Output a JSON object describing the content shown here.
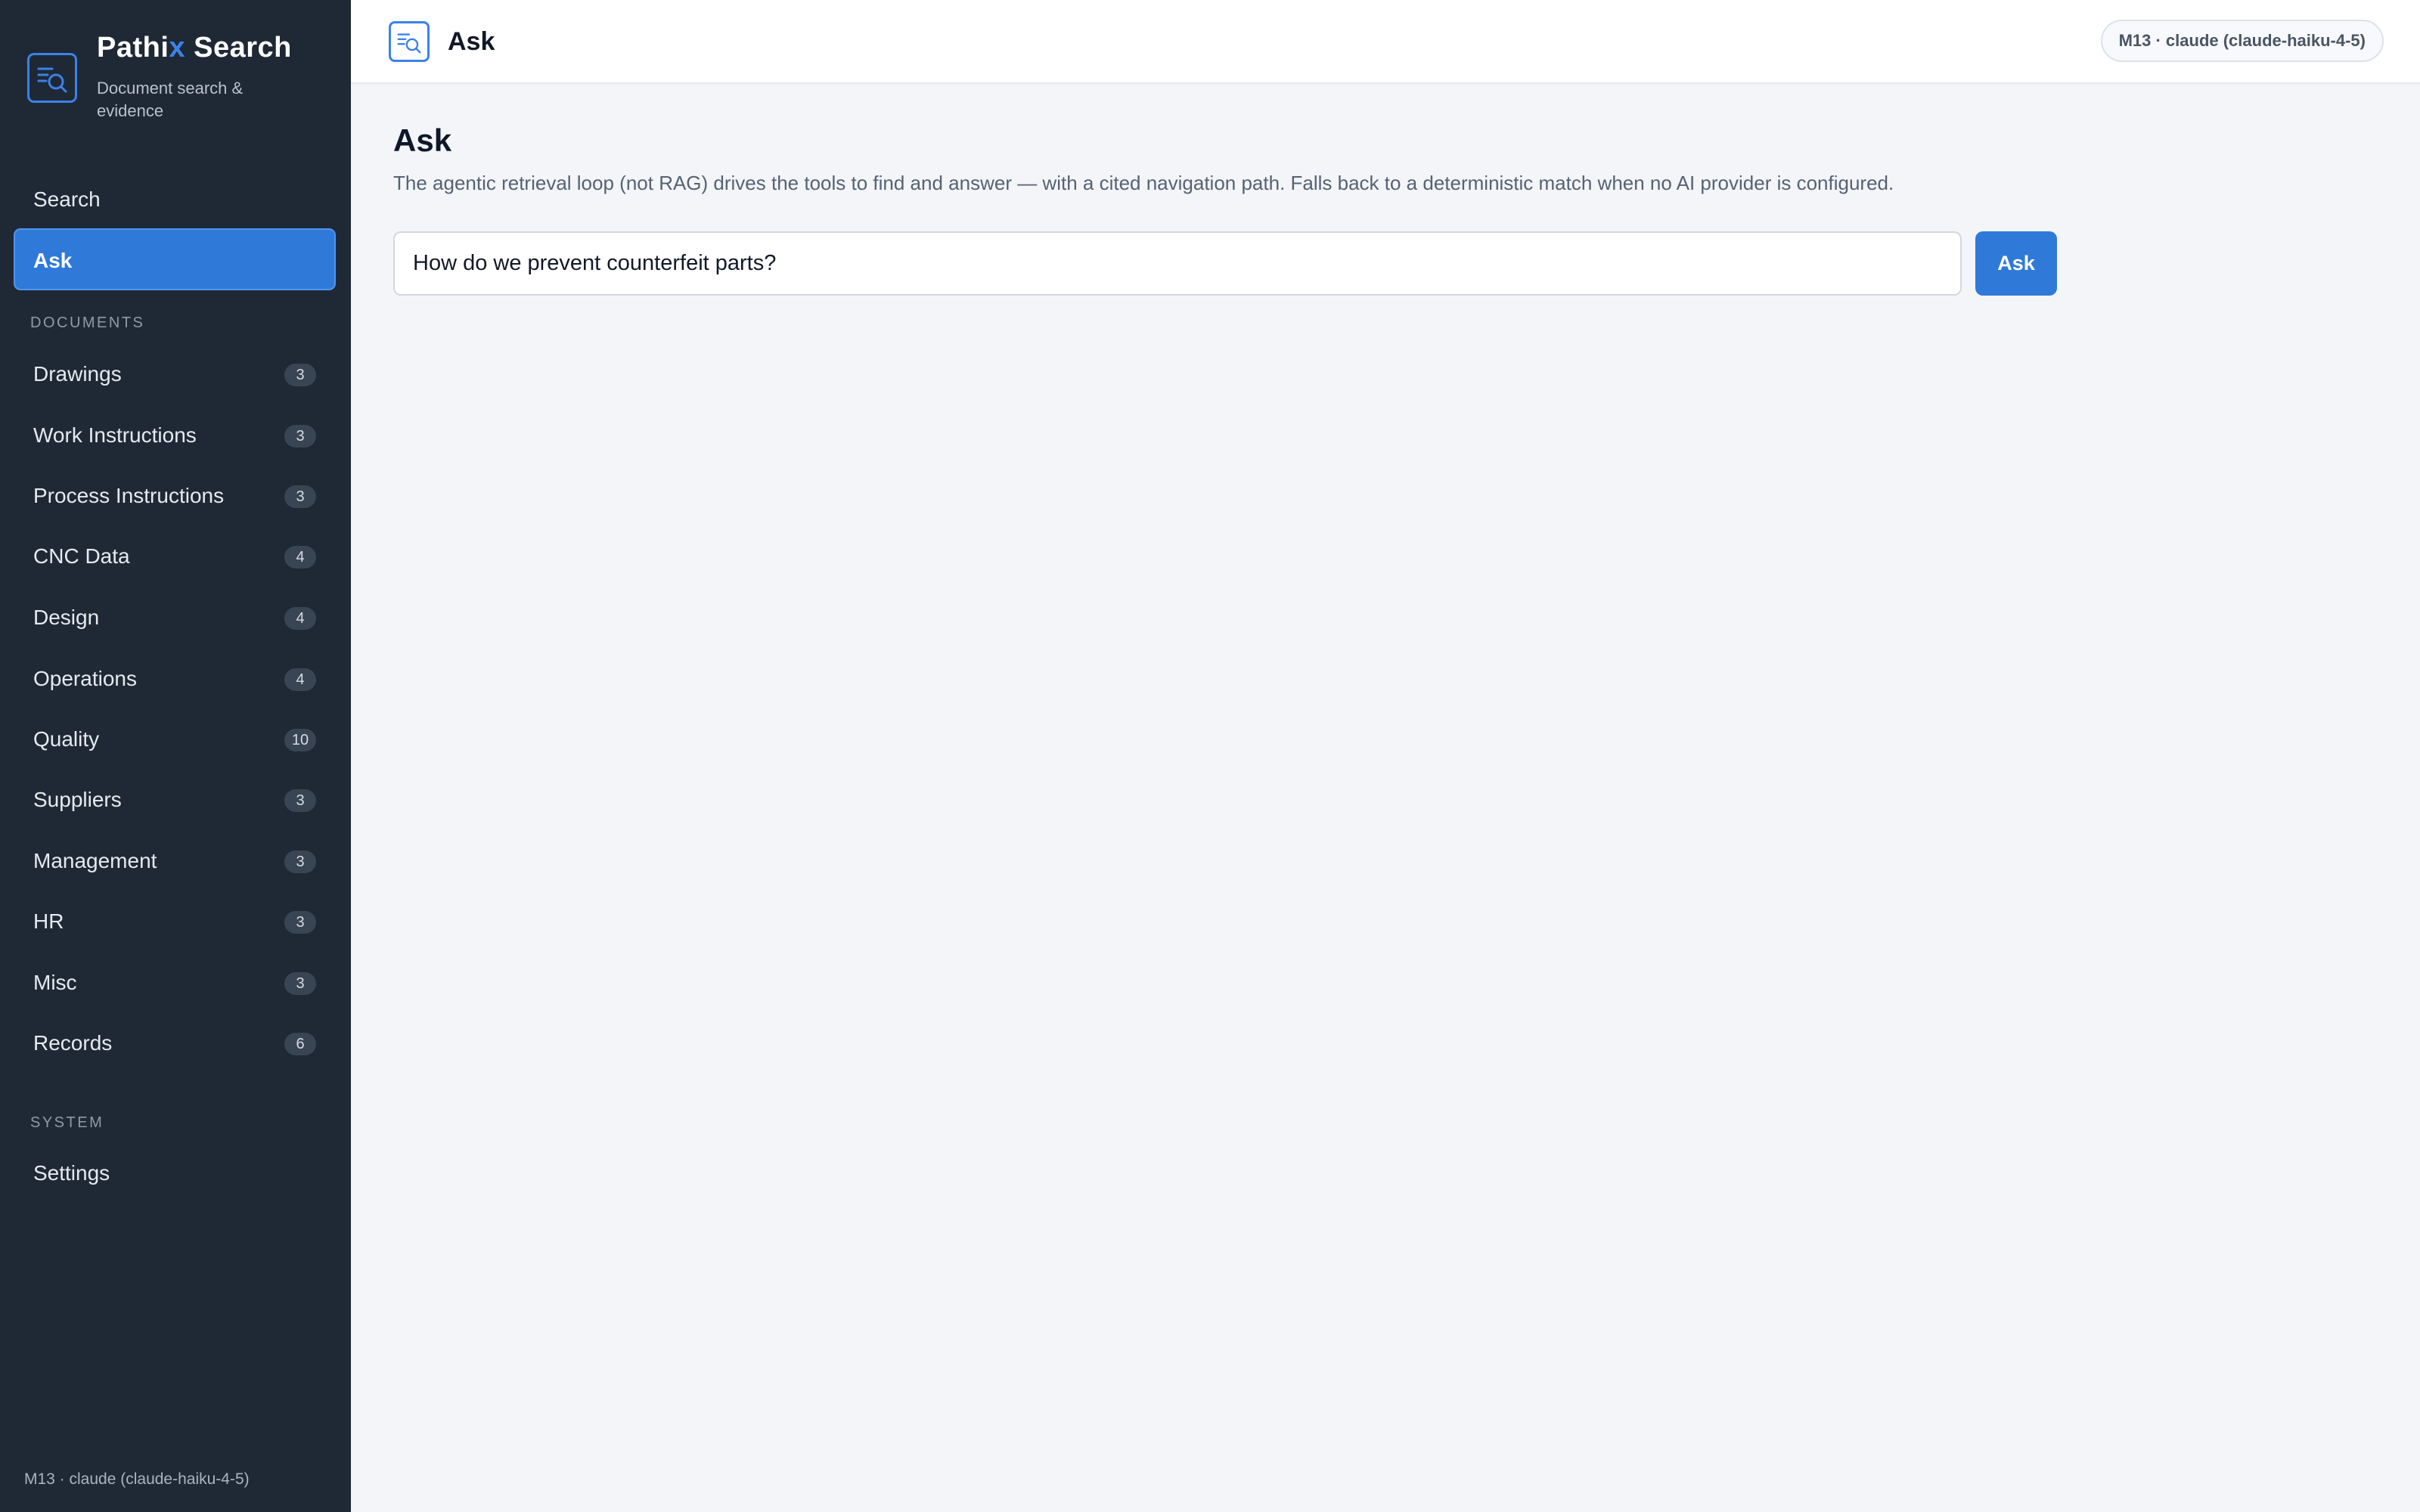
{
  "brand": {
    "title_main": "Pathi",
    "title_accent": "x",
    "title_rest": " Search",
    "subtitle": "Document search & evidence",
    "logo_icon": "search-document-icon",
    "accent_color": "#3b82e8"
  },
  "sidebar": {
    "top_items": [
      {
        "label": "Search",
        "active": false
      },
      {
        "label": "Ask",
        "active": true
      }
    ],
    "documents_section_label": "DOCUMENTS",
    "documents": [
      {
        "label": "Drawings",
        "count": "3"
      },
      {
        "label": "Work Instructions",
        "count": "3"
      },
      {
        "label": "Process Instructions",
        "count": "3"
      },
      {
        "label": "CNC Data",
        "count": "4"
      },
      {
        "label": "Design",
        "count": "4"
      },
      {
        "label": "Operations",
        "count": "4"
      },
      {
        "label": "Quality",
        "count": "10"
      },
      {
        "label": "Suppliers",
        "count": "3"
      },
      {
        "label": "Management",
        "count": "3"
      },
      {
        "label": "HR",
        "count": "3"
      },
      {
        "label": "Misc",
        "count": "3"
      },
      {
        "label": "Records",
        "count": "6"
      }
    ],
    "system_section_label": "SYSTEM",
    "system_items": [
      {
        "label": "Settings"
      }
    ],
    "footer": "M13 · claude (claude-haiku-4-5)"
  },
  "topbar": {
    "title": "Ask",
    "icon": "search-document-icon",
    "model_badge": "M13 · claude (claude-haiku-4-5)"
  },
  "main": {
    "title": "Ask",
    "description": "The agentic retrieval loop (not RAG) drives the tools to find and answer — with a cited navigation path. Falls back to a deterministic match when no AI provider is configured.",
    "query_value": "How do we prevent counterfeit parts?",
    "ask_button_label": "Ask"
  },
  "colors": {
    "sidebar_bg": "#1f2935",
    "active_item": "#2f7ad9",
    "main_bg": "#f3f5f9"
  }
}
